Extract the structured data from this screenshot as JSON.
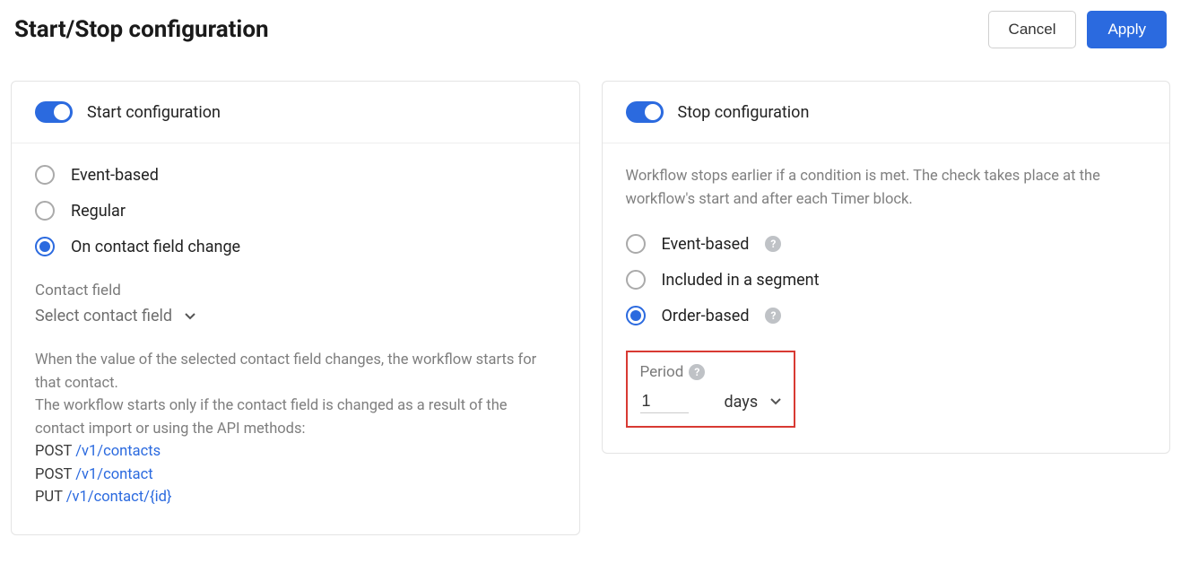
{
  "header": {
    "title": "Start/Stop configuration",
    "cancel": "Cancel",
    "apply": "Apply"
  },
  "start": {
    "title": "Start configuration",
    "opts": [
      "Event-based",
      "Regular",
      "On contact field change"
    ],
    "contact_field_label": "Contact field",
    "contact_field_placeholder": "Select contact field",
    "help1": "When the value of the selected contact field changes, the workflow starts for that contact.",
    "help2": "The workflow starts only if the contact field is changed as a result of the contact import or using the API methods:",
    "api": [
      {
        "method": "POST",
        "path": "/v1/contacts"
      },
      {
        "method": "POST",
        "path": "/v1/contact"
      },
      {
        "method": "PUT",
        "path": "/v1/contact/{id}"
      }
    ]
  },
  "stop": {
    "title": "Stop configuration",
    "desc": "Workflow stops earlier if a condition is met. The check takes place at the workflow's start and after each Timer block.",
    "opts": [
      "Event-based",
      "Included in a segment",
      "Order-based"
    ],
    "period_label": "Period",
    "period_value": "1",
    "period_unit": "days"
  }
}
